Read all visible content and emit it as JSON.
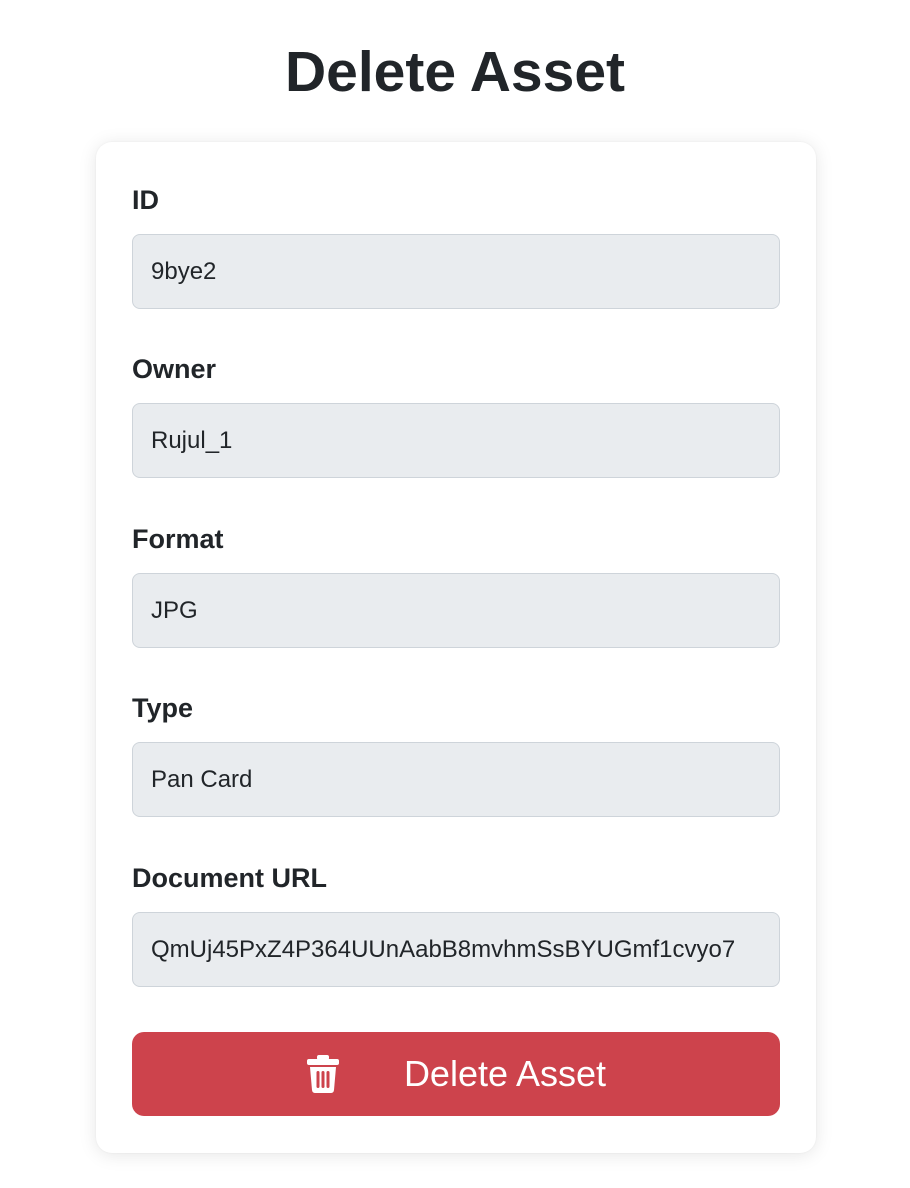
{
  "page": {
    "title": "Delete Asset"
  },
  "form": {
    "fields": [
      {
        "label": "ID",
        "value": "9bye2"
      },
      {
        "label": "Owner",
        "value": "Rujul_1"
      },
      {
        "label": "Format",
        "value": "JPG"
      },
      {
        "label": "Type",
        "value": "Pan Card"
      },
      {
        "label": "Document URL",
        "value": "QmUj45PxZ4P364UUnAabB8mvhmSsBYUGmf1cvyo7"
      }
    ],
    "submit": {
      "label": "Delete Asset",
      "icon": "trash-icon",
      "color": "#cd434c"
    }
  },
  "colors": {
    "input_background": "#e9ecef",
    "text": "#212529"
  }
}
